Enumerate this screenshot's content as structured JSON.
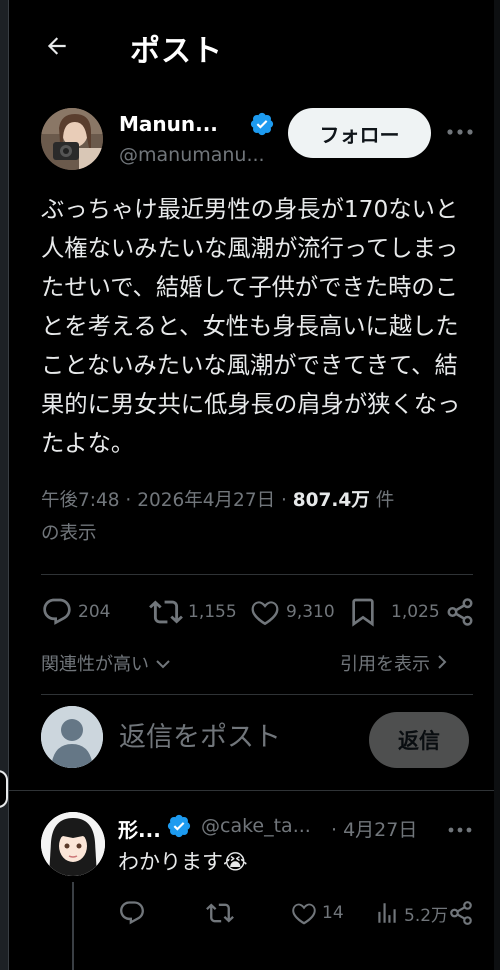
{
  "header": {
    "title": "ポスト"
  },
  "post": {
    "author": {
      "display_name": "Manun...",
      "handle": "@manumanu...",
      "verified": true
    },
    "follow_label": "フォロー",
    "text": "ぶっちゃけ最近男性の身長が170ないと人権ないみたいな風潮が流行ってしまったせいで、結婚して子供ができた時のことを考えると、女性も身長高いに越したことないみたいな風潮ができてきて、結果的に男女共に低身長の肩身が狭くなったよな。",
    "time": "午後7:48",
    "date": "2026年4月27日",
    "views_count": "807.4万",
    "views_suffix_1": "件",
    "views_suffix_2": "の表示",
    "stats": {
      "replies": "204",
      "reposts": "1,155",
      "likes": "9,310",
      "bookmarks": "1,025"
    }
  },
  "sort": {
    "label": "関連性が高い",
    "quotes_label": "引用を表示"
  },
  "composer": {
    "placeholder": "返信をポスト",
    "button_label": "返信"
  },
  "reply": {
    "display_name": "形...",
    "handle": "@cake_ta...",
    "date": "4月27日",
    "text": "わかります",
    "emoji": "😭",
    "stats": {
      "likes": "14",
      "views": "5.2万"
    }
  },
  "colors": {
    "background": "#000000",
    "text": "#e7e9ea",
    "muted": "#71767b",
    "verified": "#1d9bf0",
    "divider": "#2f3336"
  },
  "icons": [
    "arrow-left-icon",
    "verified-badge-icon",
    "more-icon",
    "reply-icon",
    "repost-icon",
    "like-icon",
    "bookmark-icon",
    "share-icon",
    "chevron-down-icon",
    "chevron-right-icon",
    "views-icon",
    "default-avatar-icon"
  ]
}
